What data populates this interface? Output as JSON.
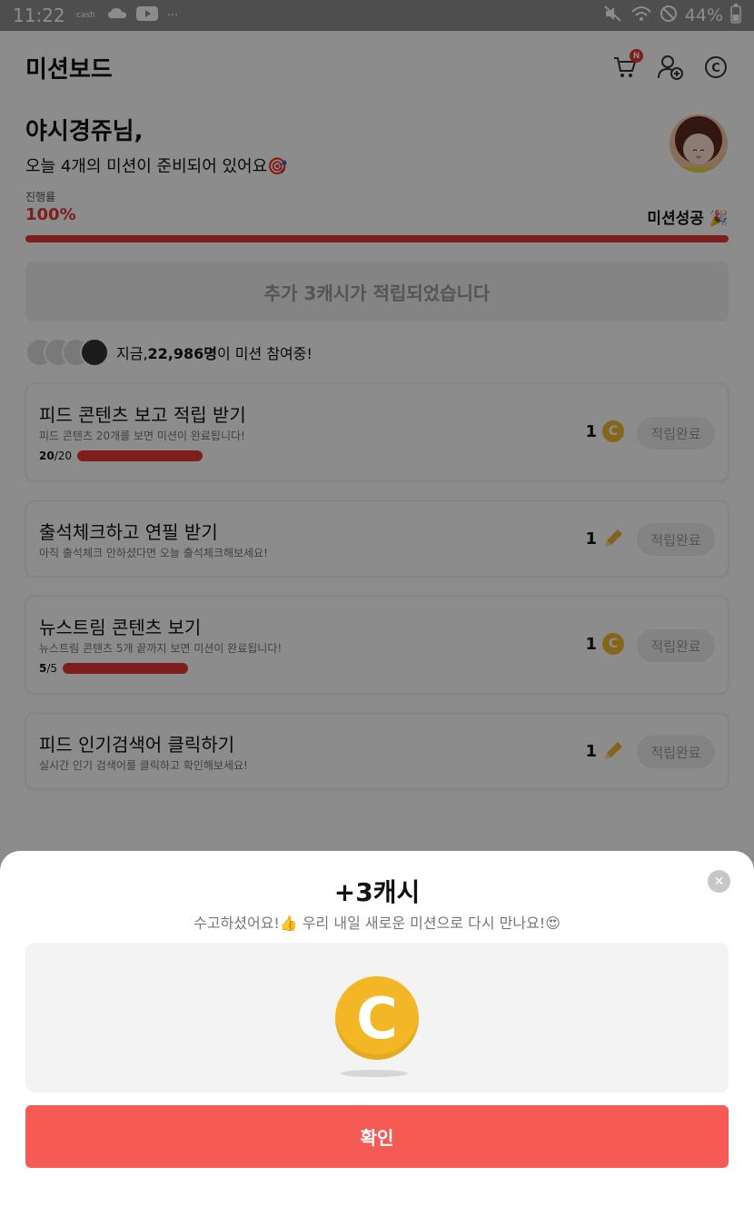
{
  "status_bar": {
    "time": "11:22",
    "icons": [
      "cashwalk-icon",
      "cloud-icon",
      "youtube-icon",
      "more-dots"
    ],
    "more": "···",
    "battery": "44%"
  },
  "header": {
    "title": "미션보드",
    "cart_badge": "N"
  },
  "greeting": {
    "name": "야시경쥬님,",
    "subtitle": "오늘 4개의 미션이 준비되어 있어요🎯"
  },
  "progress": {
    "label": "진행률",
    "percent_text": "100%",
    "value": 1.0,
    "status": "미션성공 🎉"
  },
  "bonus_banner": "추가 3캐시가 적립되었습니다",
  "participants": {
    "prefix": "지금, ",
    "count": "22,986명",
    "suffix": "이 미션 참여중!"
  },
  "missions": [
    {
      "title": "피드 콘텐츠 보고 적립 받기",
      "desc": "피드 콘텐츠 20개를 보면 미션이 완료됩니다!",
      "progress_cur": "20",
      "progress_total": "/20",
      "progress_value": 1.0,
      "reward": "1",
      "reward_type": "coin",
      "button": "적립완료"
    },
    {
      "title": "출석체크하고 연필 받기",
      "desc": "아직 출석체크 안하셨다면 오늘 출석체크해보세요!",
      "reward": "1",
      "reward_type": "pencil",
      "button": "적립완료"
    },
    {
      "title": "뉴스트림 콘텐츠 보기",
      "desc": "뉴스트림 콘텐츠 5개 끝까지 보면 미션이 완료됩니다!",
      "progress_cur": "5",
      "progress_total": "/5",
      "progress_value": 1.0,
      "reward": "1",
      "reward_type": "coin",
      "button": "적립완료"
    },
    {
      "title": "피드 인기검색어 클릭하기",
      "desc": "실시간 인기 검색어를 클릭하고 확인해보세요!",
      "reward": "1",
      "reward_type": "pencil",
      "button": "적립완료"
    }
  ],
  "sheet": {
    "title": "+3캐시",
    "subtitle": "수고하셨어요!👍 우리 내일 새로운 미션으로 다시 만나요!😍",
    "close": "✕",
    "coin_letter": "C",
    "confirm": "확인"
  },
  "colors": {
    "accent": "#e53935",
    "confirm": "#f55a55",
    "coin": "#f3b624"
  }
}
